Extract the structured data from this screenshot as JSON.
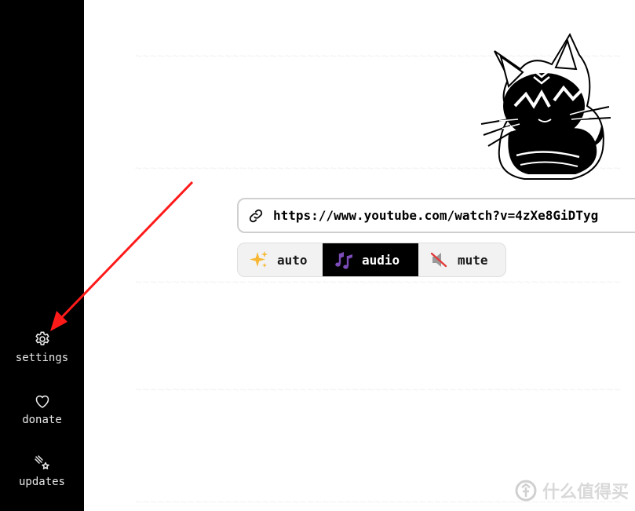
{
  "sidebar": {
    "items": [
      {
        "label": "settings",
        "icon": "gear-icon"
      },
      {
        "label": "donate",
        "icon": "heart-icon"
      },
      {
        "label": "updates",
        "icon": "comet-star-icon"
      }
    ]
  },
  "url_input": {
    "value": "https://www.youtube.com/watch?v=4zXe8GiDTyg"
  },
  "modes": {
    "selected": "audio",
    "items": [
      {
        "label": "auto",
        "icon": "sparkles-icon"
      },
      {
        "label": "audio",
        "icon": "music-notes-icon"
      },
      {
        "label": "mute",
        "icon": "muted-speaker-icon"
      }
    ]
  },
  "watermark": {
    "text": "什么值得买"
  },
  "colors": {
    "sidebar_bg": "#000000",
    "accent_arrow": "#ff1a1a",
    "active_tab_bg": "#000000",
    "music_note": "#7b4bb7",
    "sparkle": "#f7b733"
  }
}
